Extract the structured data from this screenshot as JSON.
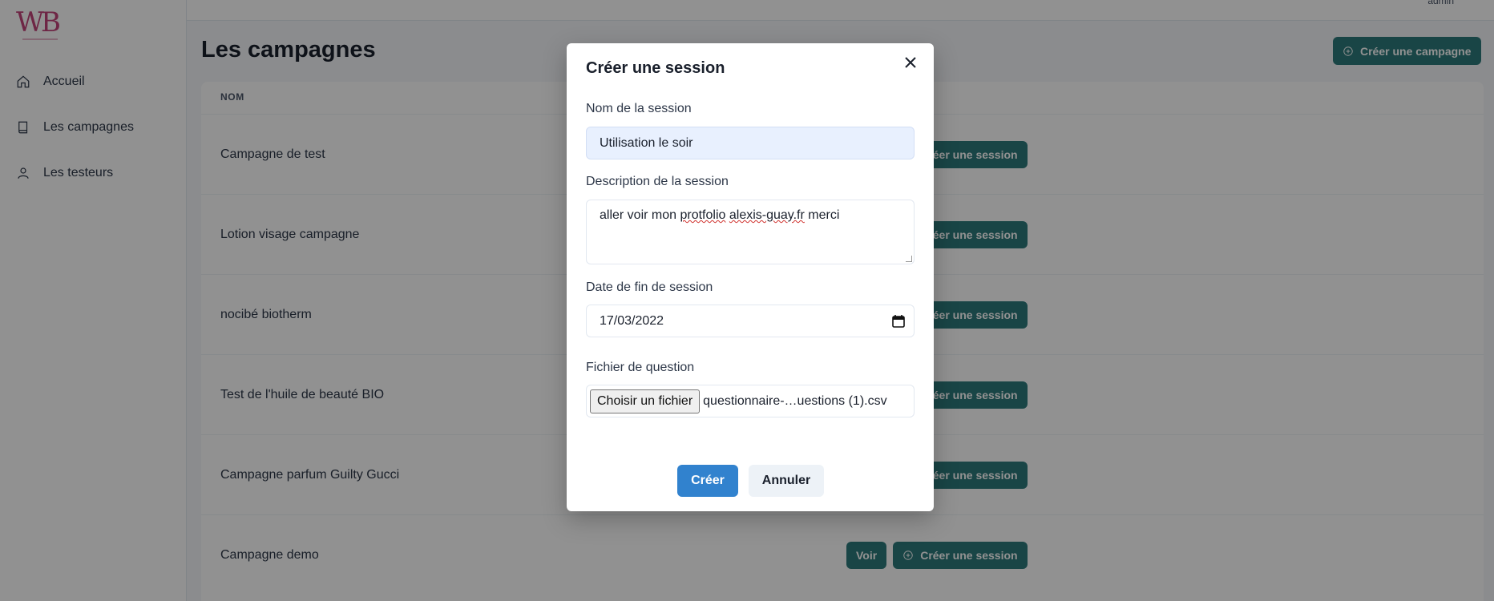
{
  "logo": {
    "text": "WB"
  },
  "topbar": {
    "user": "admin"
  },
  "sidebar": {
    "items": [
      {
        "label": "Accueil",
        "icon": "home-icon"
      },
      {
        "label": "Les campagnes",
        "icon": "book-icon"
      },
      {
        "label": "Les testeurs",
        "icon": "user-icon"
      }
    ]
  },
  "main": {
    "title": "Les campagnes",
    "create_campaign_label": "Créer une campagne",
    "table": {
      "header_name": "NOM",
      "rows": [
        {
          "name": "Campagne de test"
        },
        {
          "name": "Lotion visage campagne"
        },
        {
          "name": "nocibé biotherm"
        },
        {
          "name": "Test de l'huile de beauté BIO"
        },
        {
          "name": "Campagne parfum Guilty Gucci"
        },
        {
          "name": "Campagne demo"
        }
      ],
      "voir_label": "Voir",
      "create_session_label": "Créer une session"
    }
  },
  "modal": {
    "title": "Créer une session",
    "name_label": "Nom de la session",
    "name_value": "Utilisation le soir",
    "description_label": "Description de la session",
    "description_value": {
      "part1": "aller voir mon ",
      "word1": "protfolio",
      "space": " ",
      "word2": "alexis-guay.fr",
      "part2": " merci"
    },
    "date_label": "Date de fin de session",
    "date_value": "17/03/2022",
    "file_label": "Fichier de question",
    "file_button_label": "Choisir un fichier",
    "file_name": "questionnaire-…uestions (1).csv",
    "submit_label": "Créer",
    "cancel_label": "Annuler"
  },
  "colors": {
    "accent": "#2c7a7b",
    "primary": "#3182ce",
    "logo": "#c2437a",
    "input_fill": "#e8f0fe"
  }
}
